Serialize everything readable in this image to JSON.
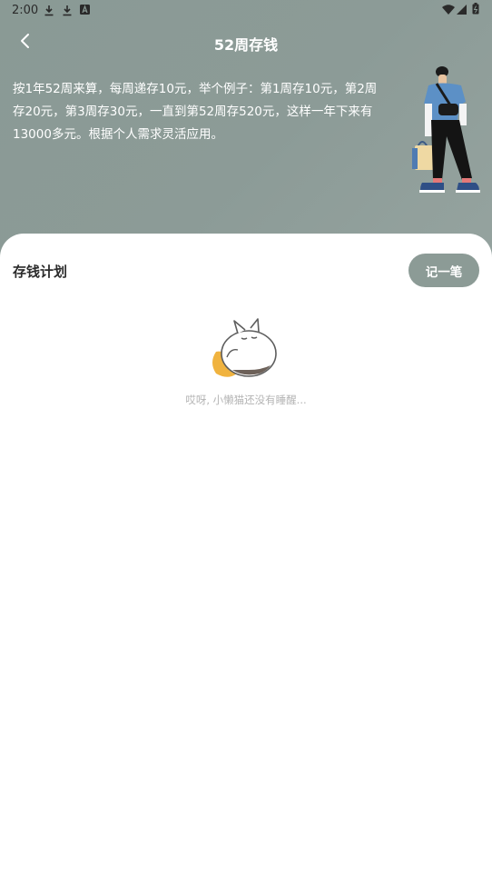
{
  "status_bar": {
    "time": "2:00",
    "left_icons": [
      "download-icon",
      "download-icon",
      "text-a-icon"
    ],
    "right_icons": [
      "wifi-icon",
      "signal-icon",
      "battery-icon"
    ]
  },
  "header": {
    "title": "52周存钱",
    "back_icon": "back-arrow-icon",
    "description": "按1年52周来算，每周递存10元，举个例子：第1周存10元，第2周存20元，第3周存30元，一直到第52周存520元，这样一年下来有13000多元。根据个人需求灵活应用。",
    "illustration": "shopping-person-illustration",
    "background_color": "#8c9b96"
  },
  "plan": {
    "title": "存钱计划",
    "record_button_label": "记一笔",
    "empty_icon": "sleeping-cat-icon",
    "empty_text": "哎呀, 小懒猫还没有睡醒..."
  }
}
